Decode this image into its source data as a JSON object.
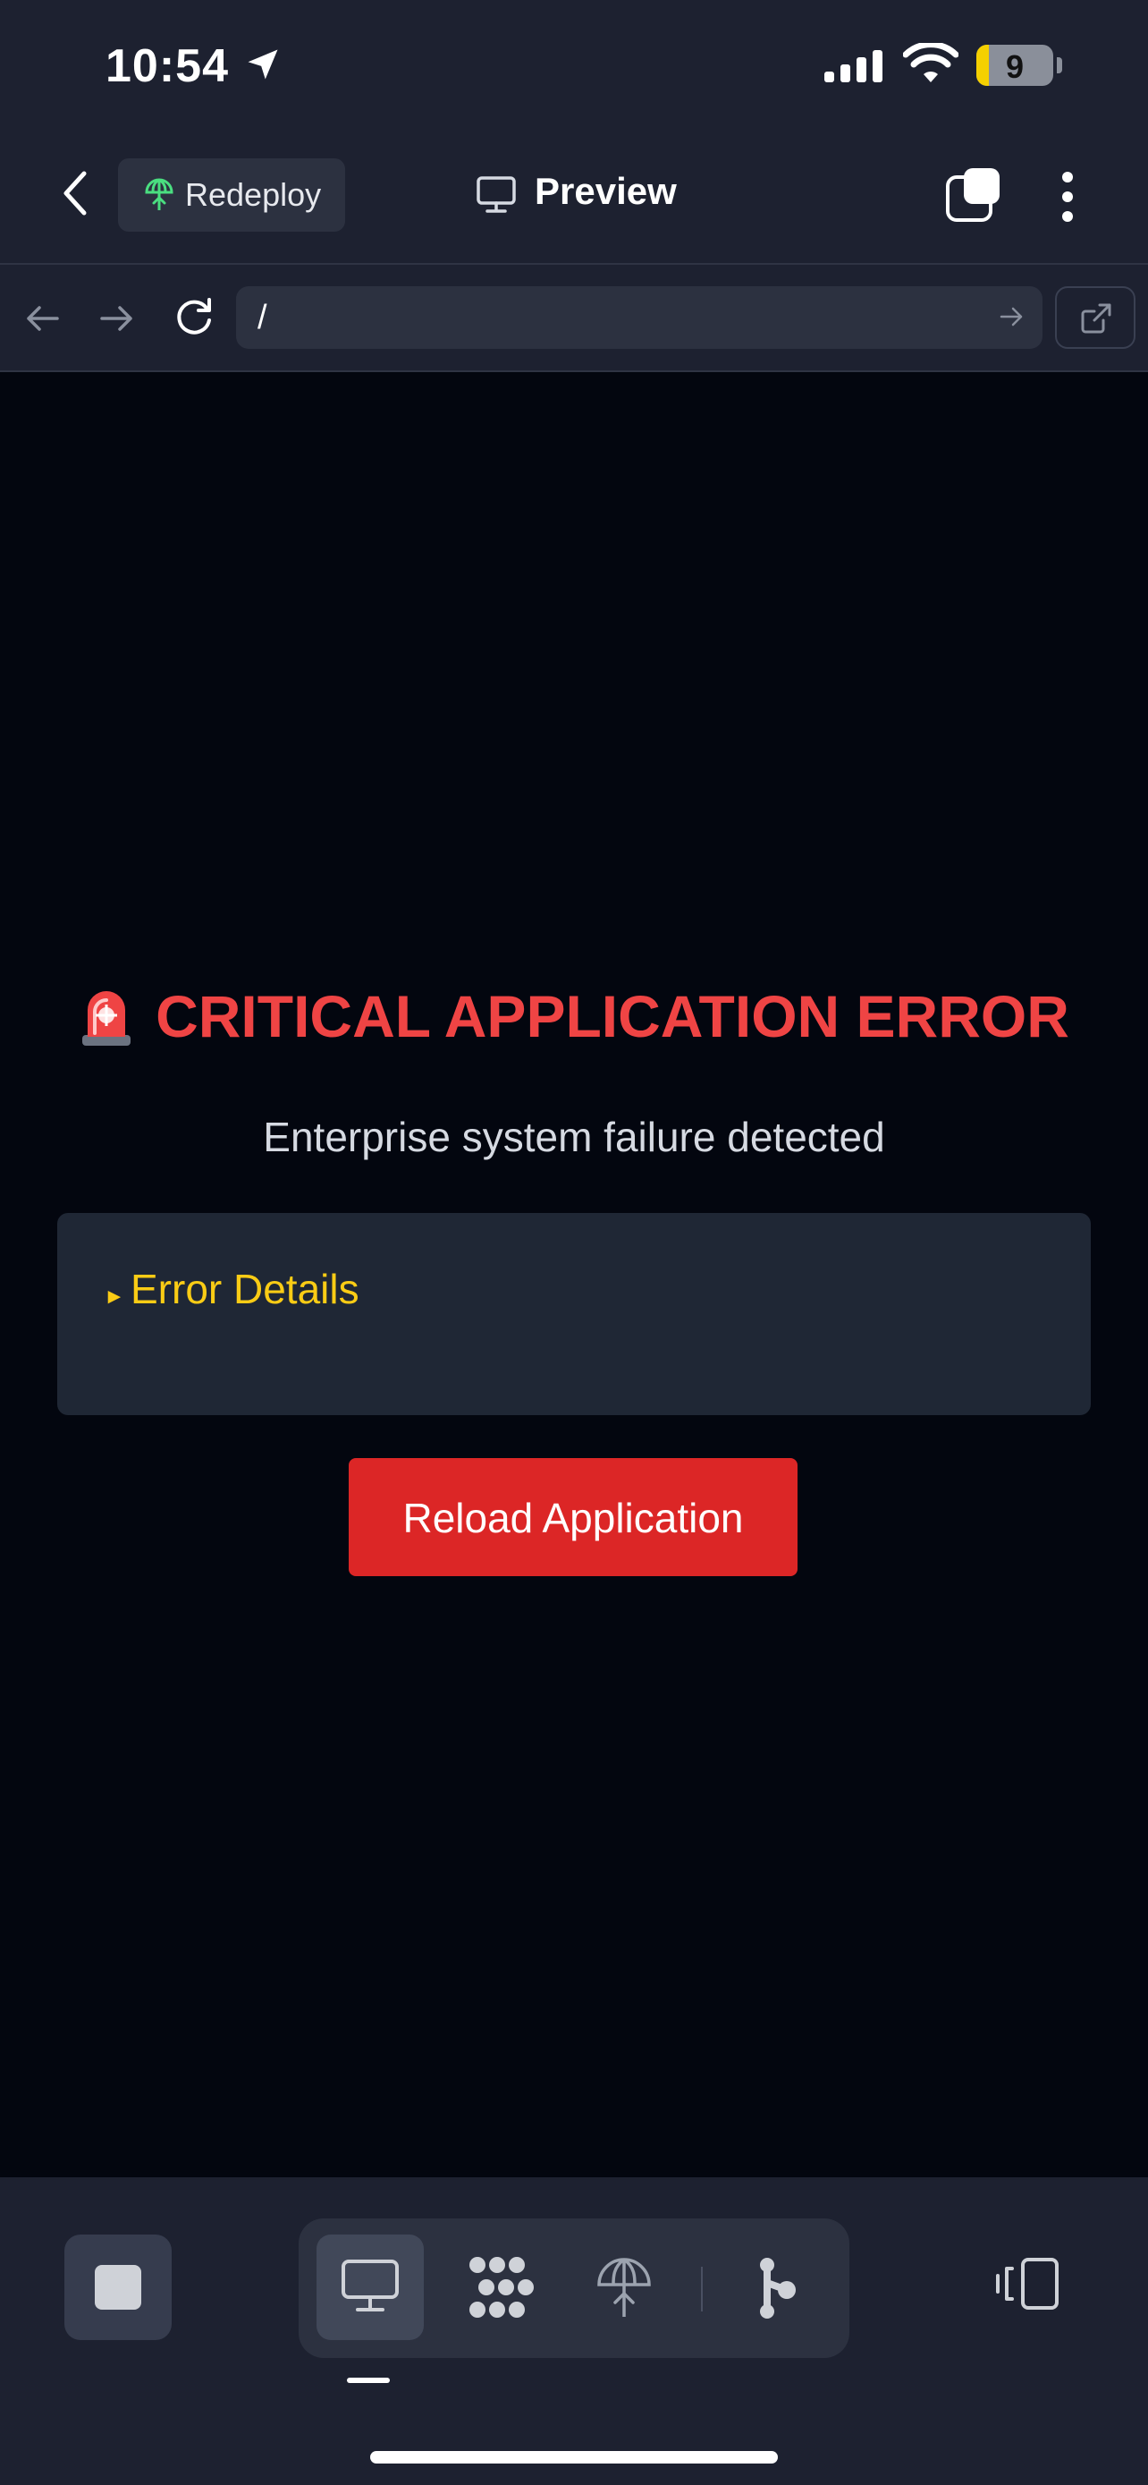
{
  "status_bar": {
    "time": "10:54",
    "battery_level": "9"
  },
  "header": {
    "redeploy_label": "Redeploy",
    "title": "Preview"
  },
  "browser": {
    "url": "/"
  },
  "content": {
    "error_title": "CRITICAL APPLICATION ERROR",
    "error_subtitle": "Enterprise system failure detected",
    "details_label": "Error Details",
    "reload_button": "Reload Application"
  },
  "icons": {
    "status": [
      "location-arrow-icon",
      "cellular-signal-icon",
      "wifi-icon",
      "battery-icon"
    ],
    "header": [
      "chevron-left-icon",
      "redeploy-icon",
      "monitor-icon",
      "tabs-icon",
      "more-vertical-icon"
    ],
    "browser": [
      "arrow-left-icon",
      "arrow-right-icon",
      "reload-icon",
      "go-arrow-icon",
      "external-link-icon"
    ],
    "content": [
      "rotating-light-icon",
      "disclosure-triangle-icon"
    ],
    "bottom": [
      "stop-icon",
      "monitor-icon",
      "console-icon",
      "deploy-icon",
      "git-icon",
      "device-rotate-icon"
    ]
  },
  "colors": {
    "background": "#03060f",
    "chrome": "#1d2130",
    "error_red": "#ef4444",
    "button_red": "#dc2626",
    "details_yellow": "#facc15",
    "details_panel": "#1f2735"
  }
}
